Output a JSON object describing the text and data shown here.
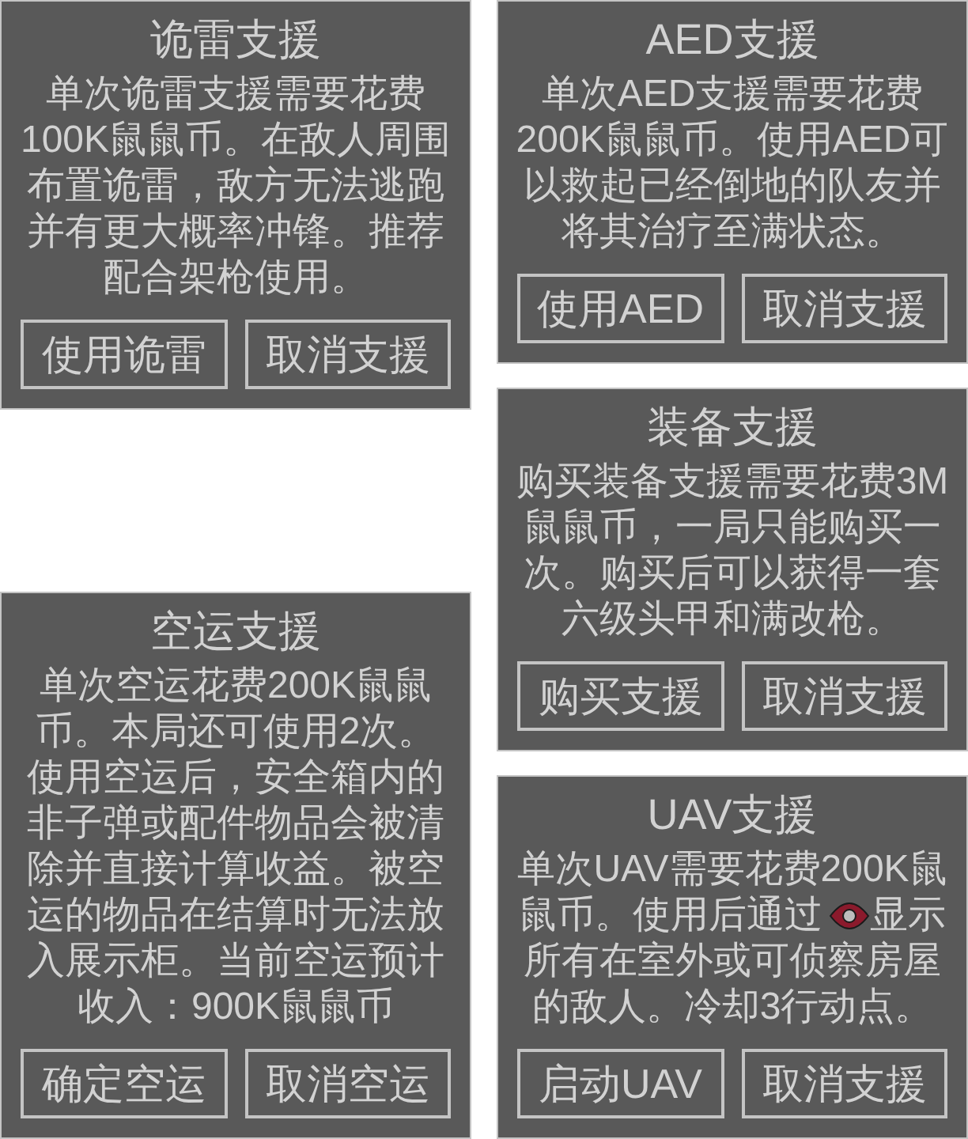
{
  "columns": [
    {
      "cards": [
        {
          "title": "诡雷支援",
          "description": "单次诡雷支援需要花费100K鼠鼠币。在敌人周围布置诡雷，敌方无法逃跑并有更大概率冲锋。推荐配合架枪使用。",
          "buttons": [
            "使用诡雷",
            "取消支援"
          ]
        },
        {
          "title": "空运支援",
          "description": "单次空运花费200K鼠鼠币。本局还可使用2次。使用空运后，安全箱内的非子弹或配件物品会被清除并直接计算收益。被空运的物品在结算时无法放入展示柜。当前空运预计收入：900K鼠鼠币",
          "buttons": [
            "确定空运",
            "取消空运"
          ]
        }
      ]
    },
    {
      "cards": [
        {
          "title": "AED支援",
          "description": "单次AED支援需要花费200K鼠鼠币。使用AED可以救起已经倒地的队友并将其治疗至满状态。",
          "buttons": [
            "使用AED",
            "取消支援"
          ]
        },
        {
          "title": "装备支援",
          "description": "购买装备支援需要花费3M鼠鼠币，一局只能购买一次。购买后可以获得一套六级头甲和满改枪。",
          "buttons": [
            "购买支援",
            "取消支援"
          ]
        },
        {
          "title": "UAV支援",
          "description": "单次UAV需要花费200K鼠鼠币。使用后通过",
          "description_after_icon": "显示所有在室外或可侦察房屋的敌人。冷却3行动点。",
          "buttons": [
            "启动UAV",
            "取消支援"
          ]
        }
      ]
    }
  ]
}
